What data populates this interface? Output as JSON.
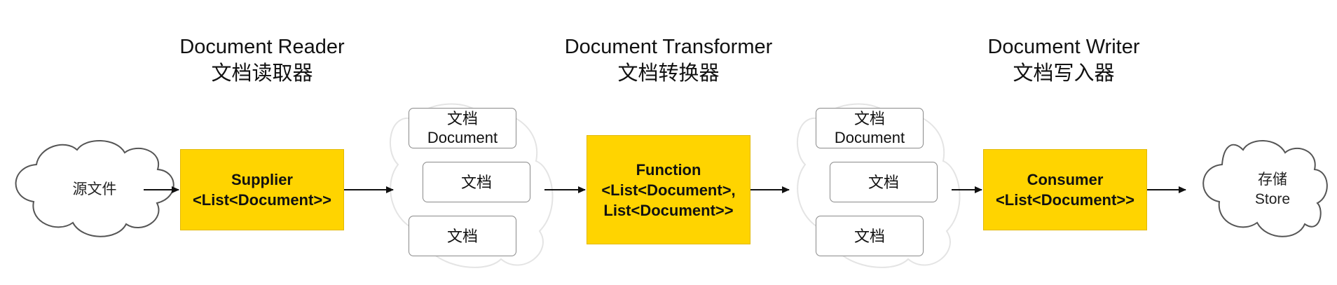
{
  "colors": {
    "accent_yellow": "#ffd400",
    "arrow": "#111111",
    "cloud_stroke": "#555555",
    "faint_cloud_stroke": "#e4e4e4",
    "box_stroke": "#8a8a8a"
  },
  "stages": {
    "reader": {
      "title_en": "Document Reader",
      "title_zh": "文档读取器"
    },
    "transformer": {
      "title_en": "Document Transformer",
      "title_zh": "文档转换器"
    },
    "writer": {
      "title_en": "Document Writer",
      "title_zh": "文档写入器"
    }
  },
  "source": {
    "label": "源文件",
    "shape": "cloud"
  },
  "store": {
    "label_zh": "存储",
    "label_en": "Store",
    "shape": "cloud"
  },
  "supplier": {
    "line1": "Supplier",
    "line2": "<List<Document>>"
  },
  "function": {
    "line1": "Function",
    "line2": "<List<Document>,",
    "line3": "List<Document>>"
  },
  "consumer": {
    "line1": "Consumer",
    "line2": "<List<Document>>"
  },
  "doc_group_1": {
    "doc1_zh": "文档",
    "doc1_en": "Document",
    "doc2": "文档",
    "doc3": "文档"
  },
  "doc_group_2": {
    "doc1_zh": "文档",
    "doc1_en": "Document",
    "doc2": "文档",
    "doc3": "文档"
  }
}
